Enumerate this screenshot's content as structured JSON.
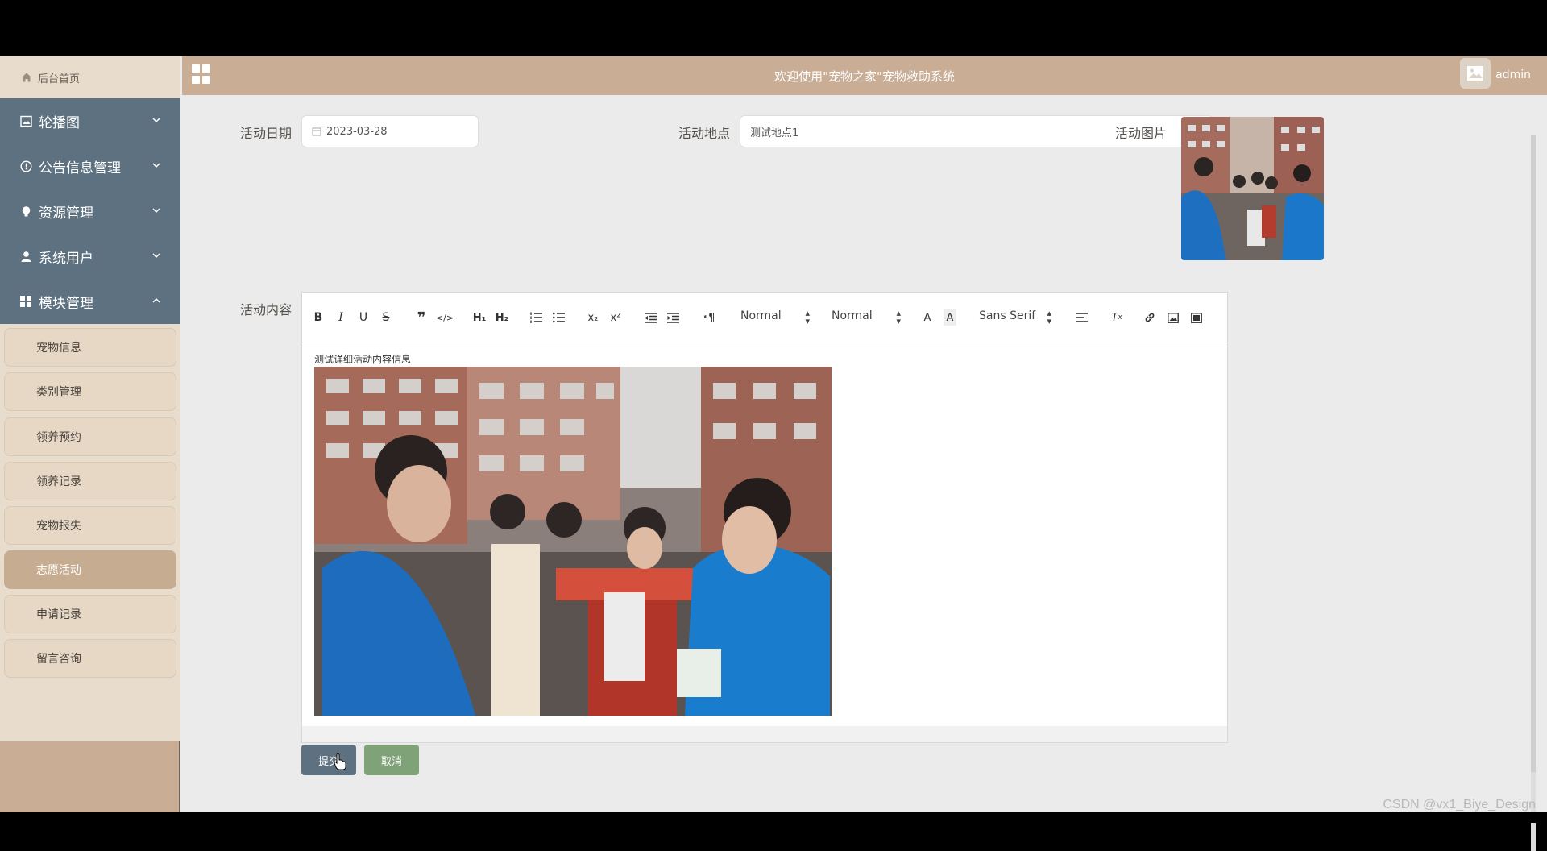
{
  "header": {
    "title": "欢迎使用\"宠物之家\"宠物救助系统",
    "username": "admin"
  },
  "sidebar": {
    "home": "后台首页",
    "groups": [
      {
        "label": "轮播图",
        "icon": "image-icon"
      },
      {
        "label": "公告信息管理",
        "icon": "alert-circle-icon"
      },
      {
        "label": "资源管理",
        "icon": "bulb-icon"
      },
      {
        "label": "系统用户",
        "icon": "user-icon"
      },
      {
        "label": "模块管理",
        "icon": "grid-icon"
      }
    ],
    "module_items": [
      {
        "label": "宠物信息"
      },
      {
        "label": "类别管理"
      },
      {
        "label": "领养预约"
      },
      {
        "label": "领养记录"
      },
      {
        "label": "宠物报失"
      },
      {
        "label": "志愿活动",
        "active": true
      },
      {
        "label": "申请记录"
      },
      {
        "label": "留言咨询"
      }
    ]
  },
  "form": {
    "date_label": "活动日期",
    "date_value": "2023-03-28",
    "place_label": "活动地点",
    "place_value": "测试地点1",
    "image_label": "活动图片",
    "content_label": "活动内容",
    "content_text": "测试详细活动内容信息"
  },
  "editor": {
    "header_select": "Normal",
    "size_select": "Normal",
    "font_select": "Sans Serif"
  },
  "buttons": {
    "submit": "提交",
    "cancel": "取消"
  },
  "watermark": "CSDN @vx1_Biye_Design",
  "colors": {
    "sidebar_group_bg": "#5e7180",
    "header_bg": "#c9ad95",
    "active_item": "#c6ad92",
    "cancel_btn": "#7fa279"
  }
}
